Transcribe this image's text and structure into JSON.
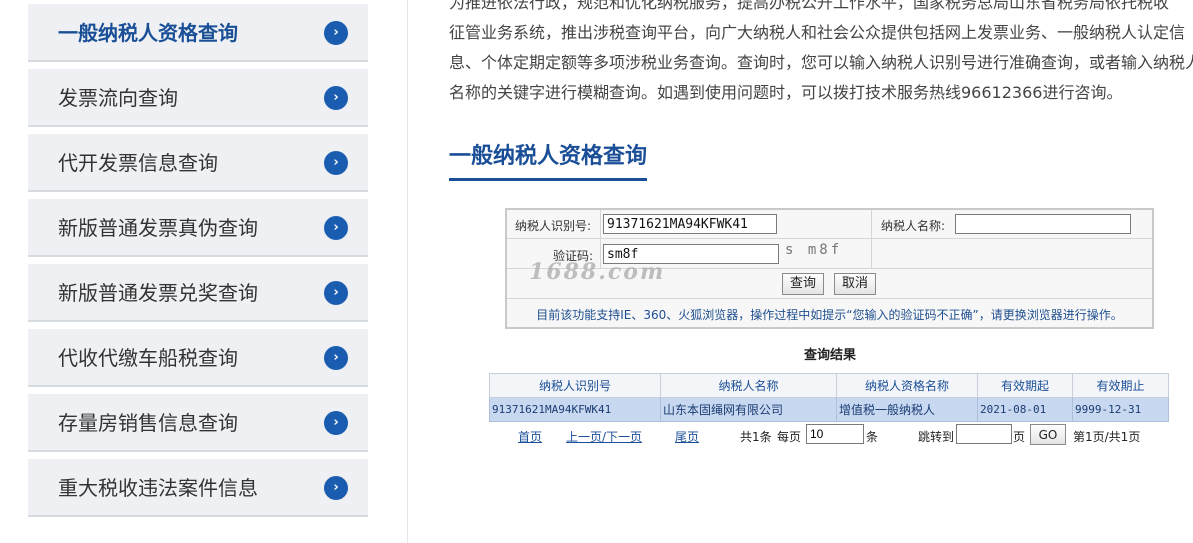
{
  "sidebar": {
    "items": [
      {
        "label": "一般纳税人资格查询",
        "active": true
      },
      {
        "label": "发票流向查询"
      },
      {
        "label": "代开发票信息查询"
      },
      {
        "label": "新版普通发票真伪查询"
      },
      {
        "label": "新版普通发票兑奖查询"
      },
      {
        "label": "代收代缴车船税查询"
      },
      {
        "label": "存量房销售信息查询"
      },
      {
        "label": "重大税收违法案件信息"
      }
    ],
    "arrow_glyph": "›"
  },
  "intro": {
    "lines": [
      "为推进依法行政，规范和优化纳税服务，提高办税公开工作水平，国家税务总局山东省税务局依托税收",
      "征管业务系统，推出涉税查询平台，向广大纳税人和社会公众提供包括网上发票业务、一般纳税人认定信",
      "息、个体定期定额等多项涉税业务查询。查询时，您可以输入纳税人识别号进行准确查询，或者输入纳税人",
      "名称的关键字进行模糊查询。如遇到使用问题时，可以拨打技术服务热线96612366进行咨询。"
    ]
  },
  "section_title": "一般纳税人资格查询",
  "form": {
    "taxpayer_id_label": "纳税人识别号:",
    "taxpayer_id_value": "91371621MA94KFWK41",
    "taxpayer_name_label": "纳税人名称:",
    "taxpayer_name_value": "",
    "captcha_label": "验证码:",
    "captcha_value": "sm8f",
    "captcha_image_text": "s m8f",
    "query_button": "查询",
    "cancel_button": "取消",
    "notice": "目前该功能支持IE、360、火狐浏览器，操作过程中如提示“您输入的验证码不正确”，请更换浏览器进行操作。"
  },
  "watermark": "1688.com",
  "results": {
    "title": "查询结果",
    "headers": [
      "纳税人识别号",
      "纳税人名称",
      "纳税人资格名称",
      "有效期起",
      "有效期止"
    ],
    "rows": [
      [
        "91371621MA94KFWK41",
        "山东本固绳网有限公司",
        "增值税一般纳税人",
        "2021-08-01",
        "9999-12-31"
      ]
    ]
  },
  "pagination": {
    "first": "首页",
    "prev_next": "上一页/下一页",
    "last": "尾页",
    "total_a": "共1条",
    "per_page_label": "每页",
    "per_page_value": "10",
    "unit": "条",
    "jump_label": "跳转到",
    "jump_value": "",
    "page_unit": "页",
    "go": "GO",
    "page_info": "第1页/共1页"
  },
  "colors": {
    "accent": "#1a4f97",
    "result_row": "#c8d8f0",
    "sidebar_bg": "#eef0f3"
  }
}
